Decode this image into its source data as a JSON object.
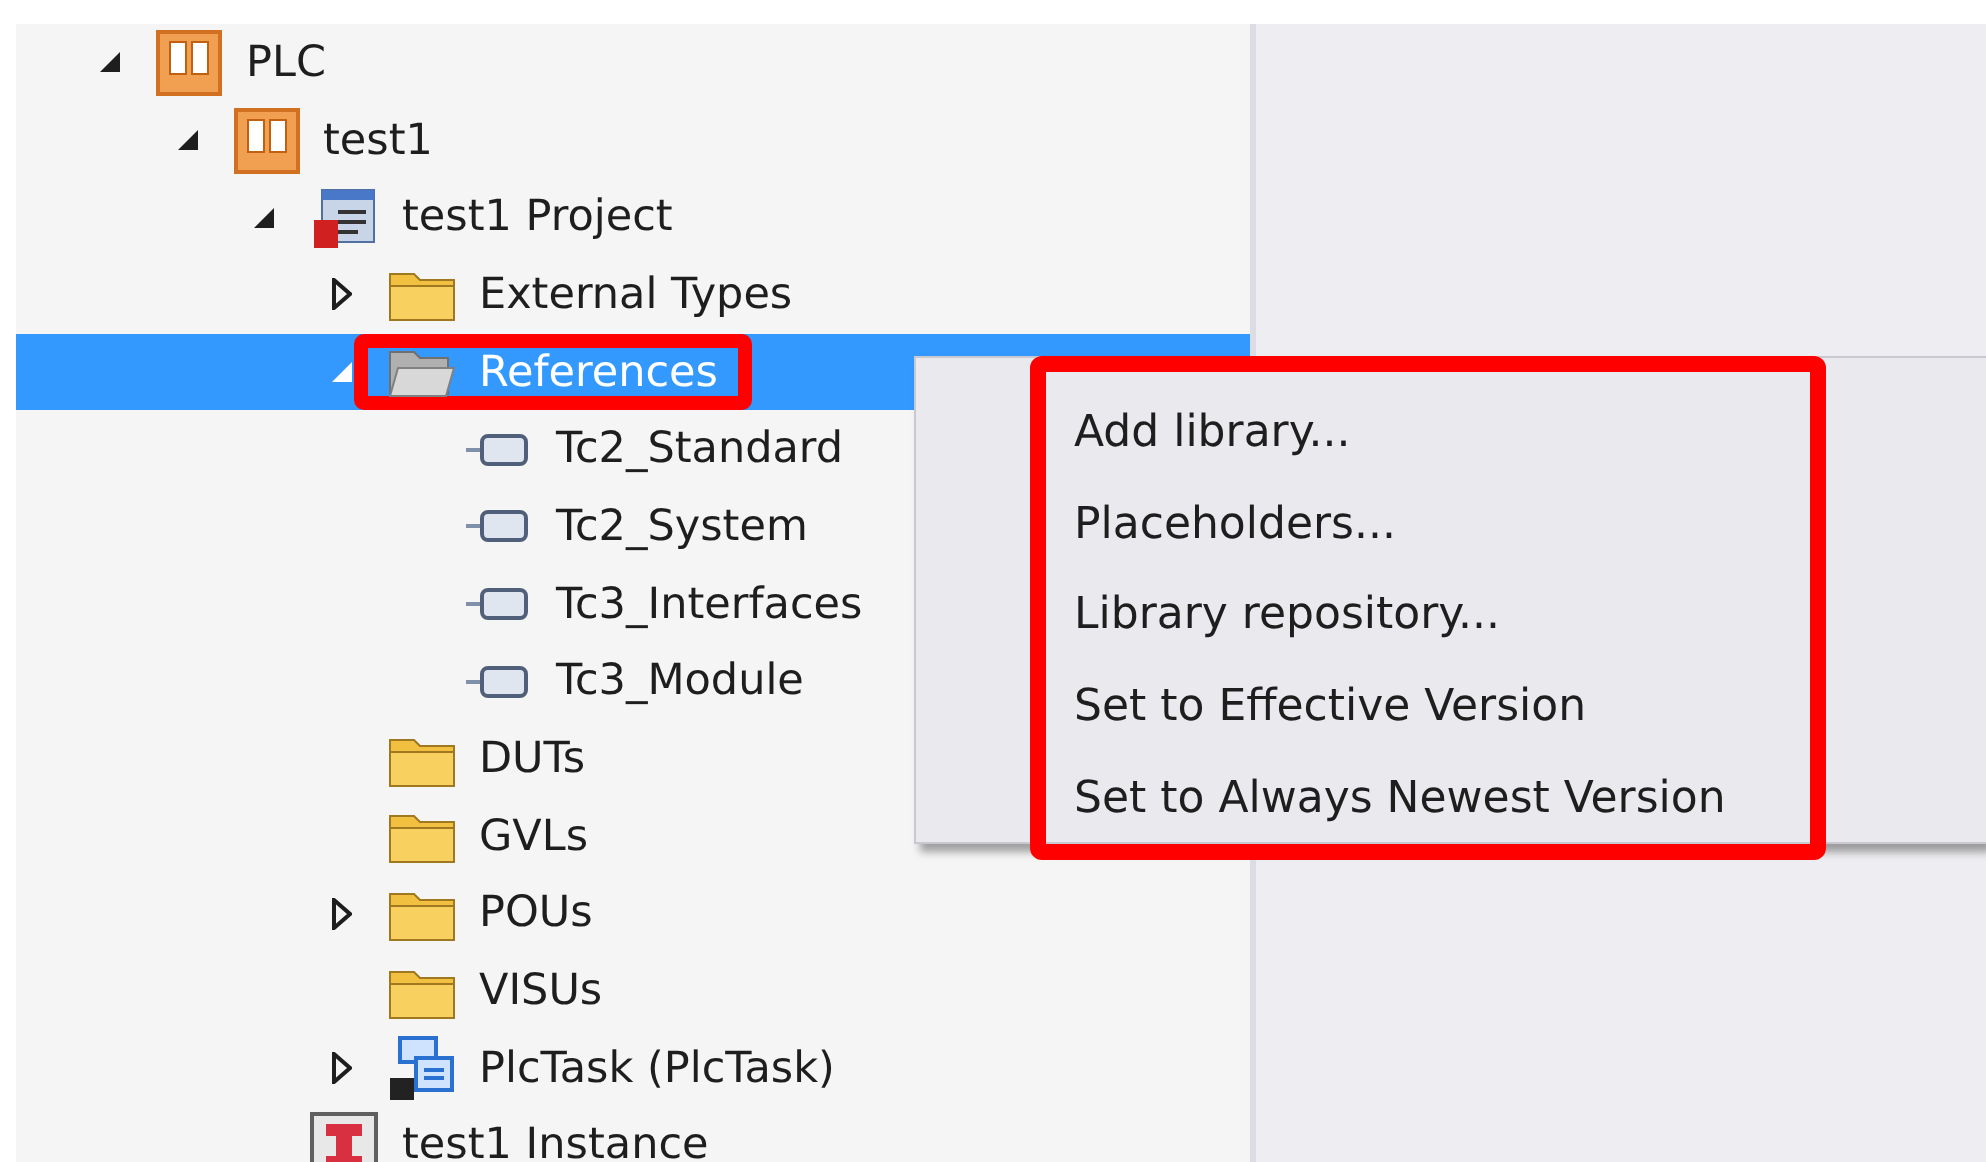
{
  "tree": [
    {
      "label": "PLC",
      "kind": "plc",
      "expanded": true,
      "selected": false,
      "children": [
        {
          "label": "test1",
          "kind": "plc",
          "expanded": true,
          "selected": false,
          "children": [
            {
              "label": "test1 Project",
              "kind": "project",
              "expanded": true,
              "selected": false,
              "children": [
                {
                  "label": "External Types",
                  "kind": "folder",
                  "expanded": false,
                  "selected": false
                },
                {
                  "label": "References",
                  "kind": "open-folder",
                  "expanded": true,
                  "selected": true,
                  "highlighted": true,
                  "children": [
                    {
                      "label": "Tc2_Standard",
                      "kind": "library",
                      "selected": false
                    },
                    {
                      "label": "Tc2_System",
                      "kind": "library",
                      "selected": false
                    },
                    {
                      "label": "Tc3_Interfaces",
                      "kind": "library",
                      "selected": false
                    },
                    {
                      "label": "Tc3_Module",
                      "kind": "library",
                      "selected": false
                    }
                  ]
                },
                {
                  "label": "DUTs",
                  "kind": "folder",
                  "selected": false
                },
                {
                  "label": "GVLs",
                  "kind": "folder",
                  "selected": false
                },
                {
                  "label": "POUs",
                  "kind": "folder",
                  "expanded": false,
                  "selected": false
                },
                {
                  "label": "VISUs",
                  "kind": "folder",
                  "selected": false
                },
                {
                  "label": "PlcTask (PlcTask)",
                  "kind": "task",
                  "expanded": false,
                  "selected": false
                }
              ]
            },
            {
              "label": "test1 Instance",
              "kind": "instance",
              "selected": false
            }
          ]
        }
      ]
    }
  ],
  "context_menu": {
    "highlighted": true,
    "items": [
      "Add library...",
      "Placeholders...",
      "Library repository...",
      "Set to Effective Version",
      "Set to Always Newest Version"
    ]
  }
}
